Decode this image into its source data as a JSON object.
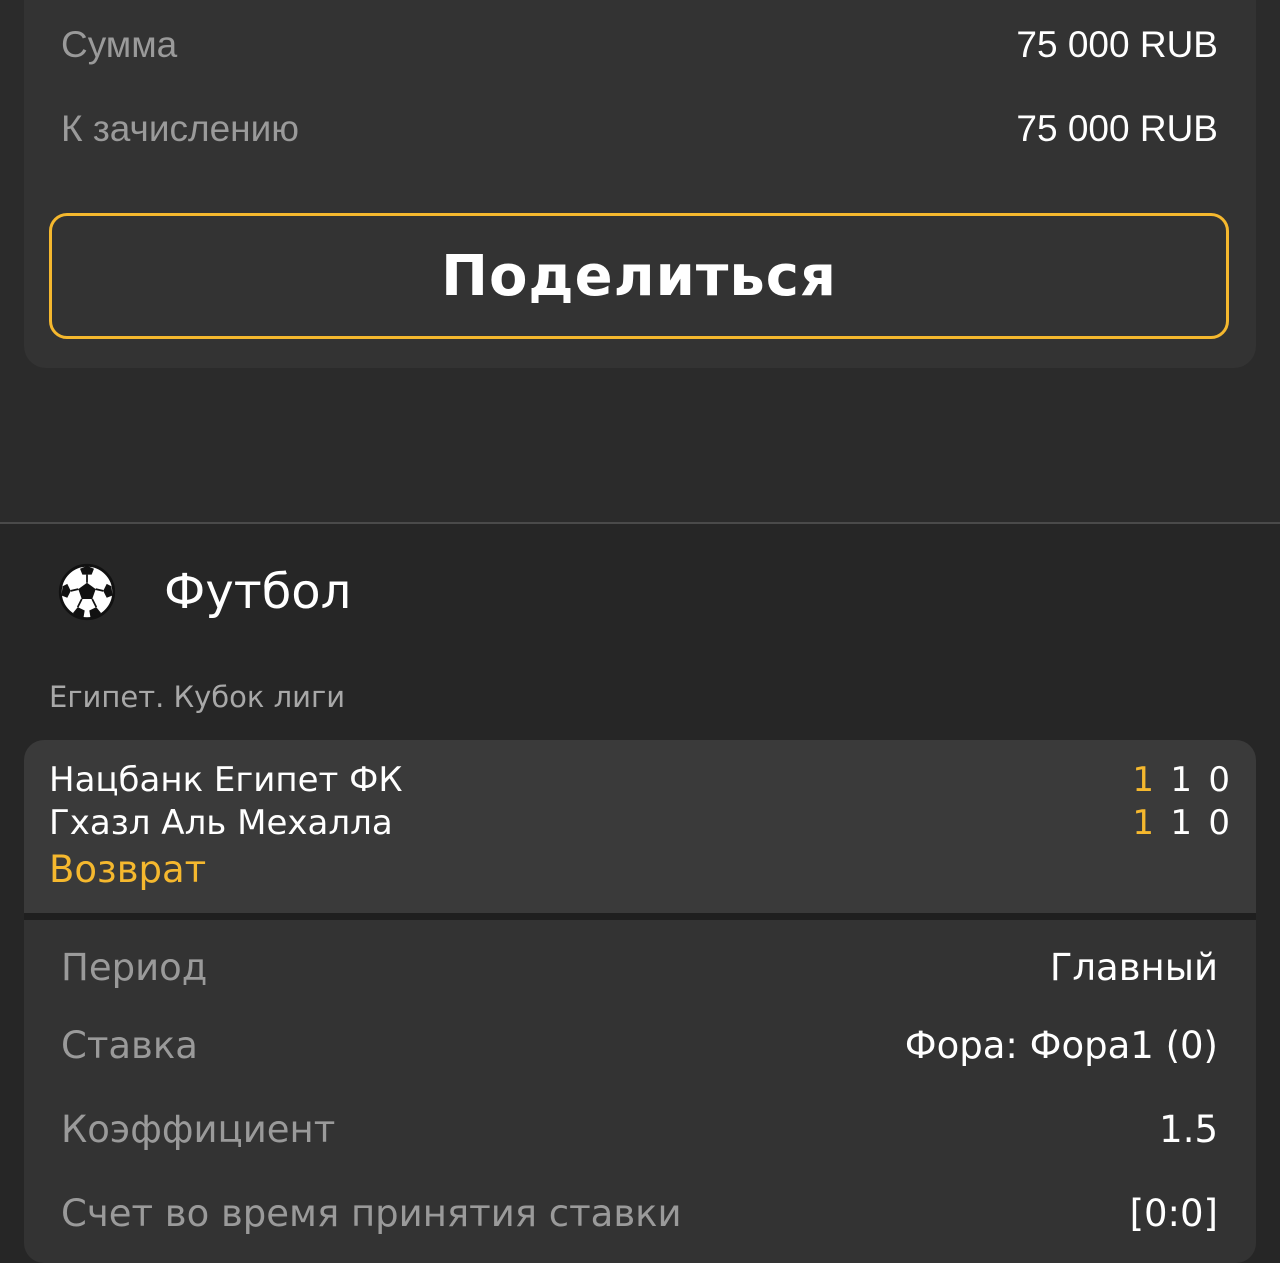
{
  "summary": {
    "amount_label": "Сумма",
    "amount_value": "75 000 RUB",
    "credit_label": "К зачислению",
    "credit_value": "75 000 RUB",
    "share_label": "Поделиться"
  },
  "sport": {
    "icon": "soccer-ball-icon",
    "title": "Футбол"
  },
  "league": "Египет. Кубок лиги",
  "match": {
    "teams": [
      {
        "name": "Нацбанк Египет ФК",
        "scores": [
          "1",
          "1",
          "0"
        ]
      },
      {
        "name": "Гхазл Аль Мехалла",
        "scores": [
          "1",
          "1",
          "0"
        ]
      }
    ],
    "status": "Возврат"
  },
  "details": [
    {
      "label": "Период",
      "value": "Главный"
    },
    {
      "label": "Ставка",
      "value": "Фора: Фора1 (0)"
    },
    {
      "label": "Коэффициент",
      "value": "1.5"
    },
    {
      "label": "Счет во время принятия ставки",
      "value": "[0:0]"
    }
  ],
  "colors": {
    "accent": "#f5b82e",
    "card": "#333333",
    "match_card": "#3a3a3a",
    "label": "#9a9a9a"
  }
}
